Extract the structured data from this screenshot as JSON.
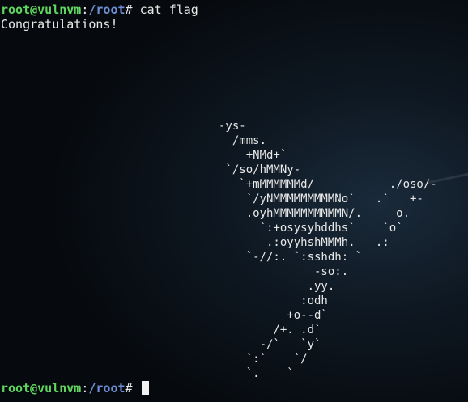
{
  "prompt": {
    "user_host": "root@vulnvm",
    "separator": ":",
    "path": "/root",
    "symbol": "# "
  },
  "commands": {
    "first": "cat flag"
  },
  "output": {
    "message": "Congratulations!",
    "art": "-ys-\n  /mms.\n    +NMd+`\n `/so/hMMNy-\n   `+mMMMMMMd/           ./oso/-\n    `/yNMMMMMMMMMNo`   .`   +-\n    .oyhMMMMMMMMMMN/.     o.\n      `:+osysyhddhs`    `o`\n       .:oyyhshMMMh.   .:\n    `-//:. `:sshdh: `\n              -so:.\n             .yy.\n            :odh\n          +o--d`\n        /+. .d`\n      -/`   `y`\n    `:`    `/\n    `.    `"
  },
  "colors": {
    "background": "#06090d",
    "prompt_user": "#5fd75f",
    "prompt_path": "#6f8fd8",
    "text": "#e8e8e8"
  }
}
